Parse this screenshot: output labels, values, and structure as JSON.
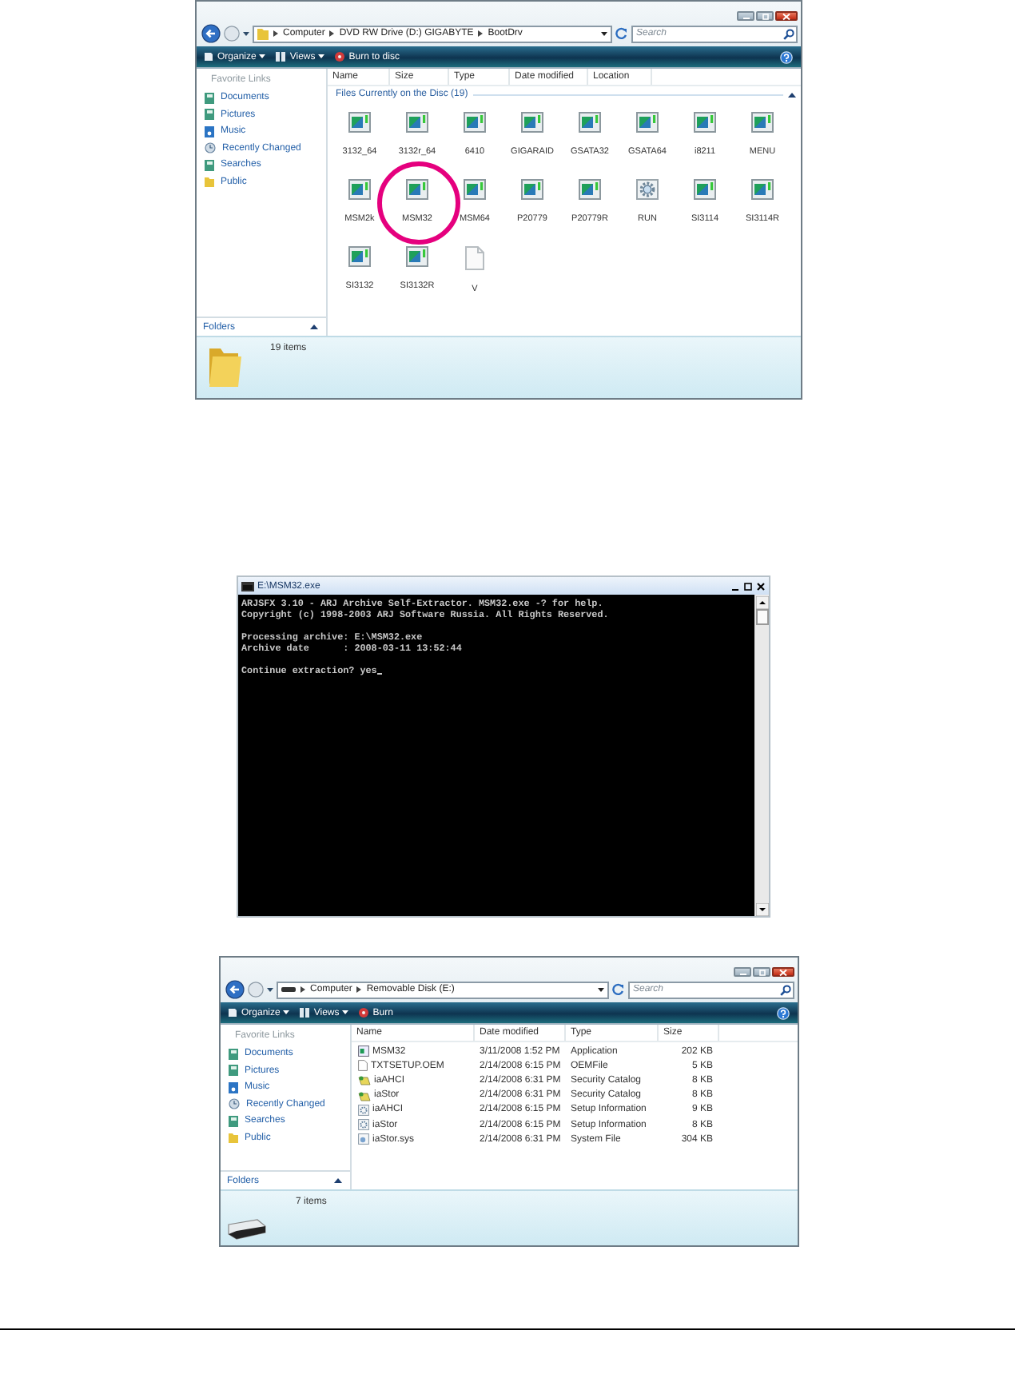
{
  "screens": [
    {
      "kind": "explorer",
      "address": {
        "kind": "folder",
        "parts": [
          "Computer",
          "DVD RW Drive (D:) GIGABYTE",
          "BootDrv"
        ]
      },
      "search": {
        "placeholder": "Search"
      },
      "toolbar": [
        {
          "label": "Organize",
          "kind": "organize",
          "menu": true
        },
        {
          "label": "Views",
          "kind": "views",
          "menu": true
        },
        {
          "label": "Burn to disc",
          "kind": "burn",
          "menu": false
        }
      ],
      "favorites": {
        "title": "Favorite Links",
        "links": [
          {
            "label": "Documents",
            "kind": "library"
          },
          {
            "label": "Pictures",
            "kind": "library"
          },
          {
            "label": "Music",
            "kind": "music"
          },
          {
            "label": "Recently Changed",
            "kind": "recent"
          },
          {
            "label": "Searches",
            "kind": "library"
          },
          {
            "label": "Public",
            "kind": "folder"
          }
        ]
      },
      "folders": "Folders",
      "columns": [
        "Name",
        "Size",
        "Type",
        "Date modified",
        "Location"
      ],
      "group": "Files Currently on the Disc (19)",
      "files": [
        {
          "name": "3132_64",
          "kind": "program",
          "highlighted": false
        },
        {
          "name": "3132r_64",
          "kind": "program",
          "highlighted": false
        },
        {
          "name": "6410",
          "kind": "program",
          "highlighted": false
        },
        {
          "name": "GIGARAID",
          "kind": "program",
          "highlighted": false
        },
        {
          "name": "GSATA32",
          "kind": "program",
          "highlighted": false
        },
        {
          "name": "GSATA64",
          "kind": "program",
          "highlighted": false
        },
        {
          "name": "i8211",
          "kind": "program",
          "highlighted": false
        },
        {
          "name": "MENU",
          "kind": "program",
          "highlighted": false
        },
        {
          "name": "MSM2k",
          "kind": "program",
          "highlighted": false
        },
        {
          "name": "MSM32",
          "kind": "program",
          "highlighted": true
        },
        {
          "name": "MSM64",
          "kind": "program",
          "highlighted": false
        },
        {
          "name": "P20779",
          "kind": "program",
          "highlighted": false
        },
        {
          "name": "P20779R",
          "kind": "program",
          "highlighted": false
        },
        {
          "name": "RUN",
          "kind": "batch",
          "highlighted": false
        },
        {
          "name": "SI3114",
          "kind": "program",
          "highlighted": false
        },
        {
          "name": "SI3114R",
          "kind": "program",
          "highlighted": false
        },
        {
          "name": "SI3132",
          "kind": "program",
          "highlighted": false
        },
        {
          "name": "SI3132R",
          "kind": "program",
          "highlighted": false
        },
        {
          "name": "V",
          "kind": "blank",
          "highlighted": false
        }
      ],
      "details_pane": {
        "kind": "folder",
        "text": "19 items"
      }
    },
    {
      "kind": "console",
      "title": "E:\\MSM32.exe",
      "paragraphs": [
        [
          "ARJSFX 3.10 - ARJ Archive Self-Extractor. MSM32.exe -? for help.",
          "Copyright (c) 1998-2003 ARJ Software Russia. All Rights Reserved."
        ],
        [
          "Processing archive: E:\\MSM32.exe",
          "Archive date      : 2008-03-11 13:52:44"
        ],
        [
          "Continue extraction? yes"
        ]
      ],
      "cursor": true
    },
    {
      "kind": "explorer",
      "address": {
        "kind": "drive",
        "parts": [
          "Computer",
          "Removable Disk (E:)"
        ]
      },
      "search": {
        "placeholder": "Search"
      },
      "toolbar": [
        {
          "label": "Organize",
          "kind": "organize",
          "menu": true
        },
        {
          "label": "Views",
          "kind": "views",
          "menu": true
        },
        {
          "label": "Burn",
          "kind": "burn",
          "menu": false
        }
      ],
      "favorites": {
        "title": "Favorite Links",
        "links": [
          {
            "label": "Documents",
            "kind": "library"
          },
          {
            "label": "Pictures",
            "kind": "library"
          },
          {
            "label": "Music",
            "kind": "music"
          },
          {
            "label": "Recently Changed",
            "kind": "recent"
          },
          {
            "label": "Searches",
            "kind": "library"
          },
          {
            "label": "Public",
            "kind": "folder"
          }
        ]
      },
      "folders": "Folders",
      "columns": [
        "Name",
        "Date modified",
        "Type",
        "Size"
      ],
      "rows": [
        {
          "name": "MSM32",
          "date": "3/11/2008 1:52 PM",
          "type": "Application",
          "size": "202 KB",
          "kind": "application"
        },
        {
          "name": "TXTSETUP.OEM",
          "date": "2/14/2008 6:15 PM",
          "type": "OEMFile",
          "size": "5 KB",
          "kind": "document"
        },
        {
          "name": "iaAHCI",
          "date": "2/14/2008 6:31 PM",
          "type": "Security Catalog",
          "size": "8 KB",
          "kind": "catalog"
        },
        {
          "name": "iaStor",
          "date": "2/14/2008 6:31 PM",
          "type": "Security Catalog",
          "size": "8 KB",
          "kind": "catalog"
        },
        {
          "name": "iaAHCI",
          "date": "2/14/2008 6:15 PM",
          "type": "Setup Information",
          "size": "9 KB",
          "kind": "setup"
        },
        {
          "name": "iaStor",
          "date": "2/14/2008 6:15 PM",
          "type": "Setup Information",
          "size": "8 KB",
          "kind": "setup"
        },
        {
          "name": "iaStor.sys",
          "date": "2/14/2008 6:31 PM",
          "type": "System File",
          "size": "304 KB",
          "kind": "system"
        }
      ],
      "details_pane": {
        "kind": "drive",
        "text": "7 items"
      }
    }
  ]
}
